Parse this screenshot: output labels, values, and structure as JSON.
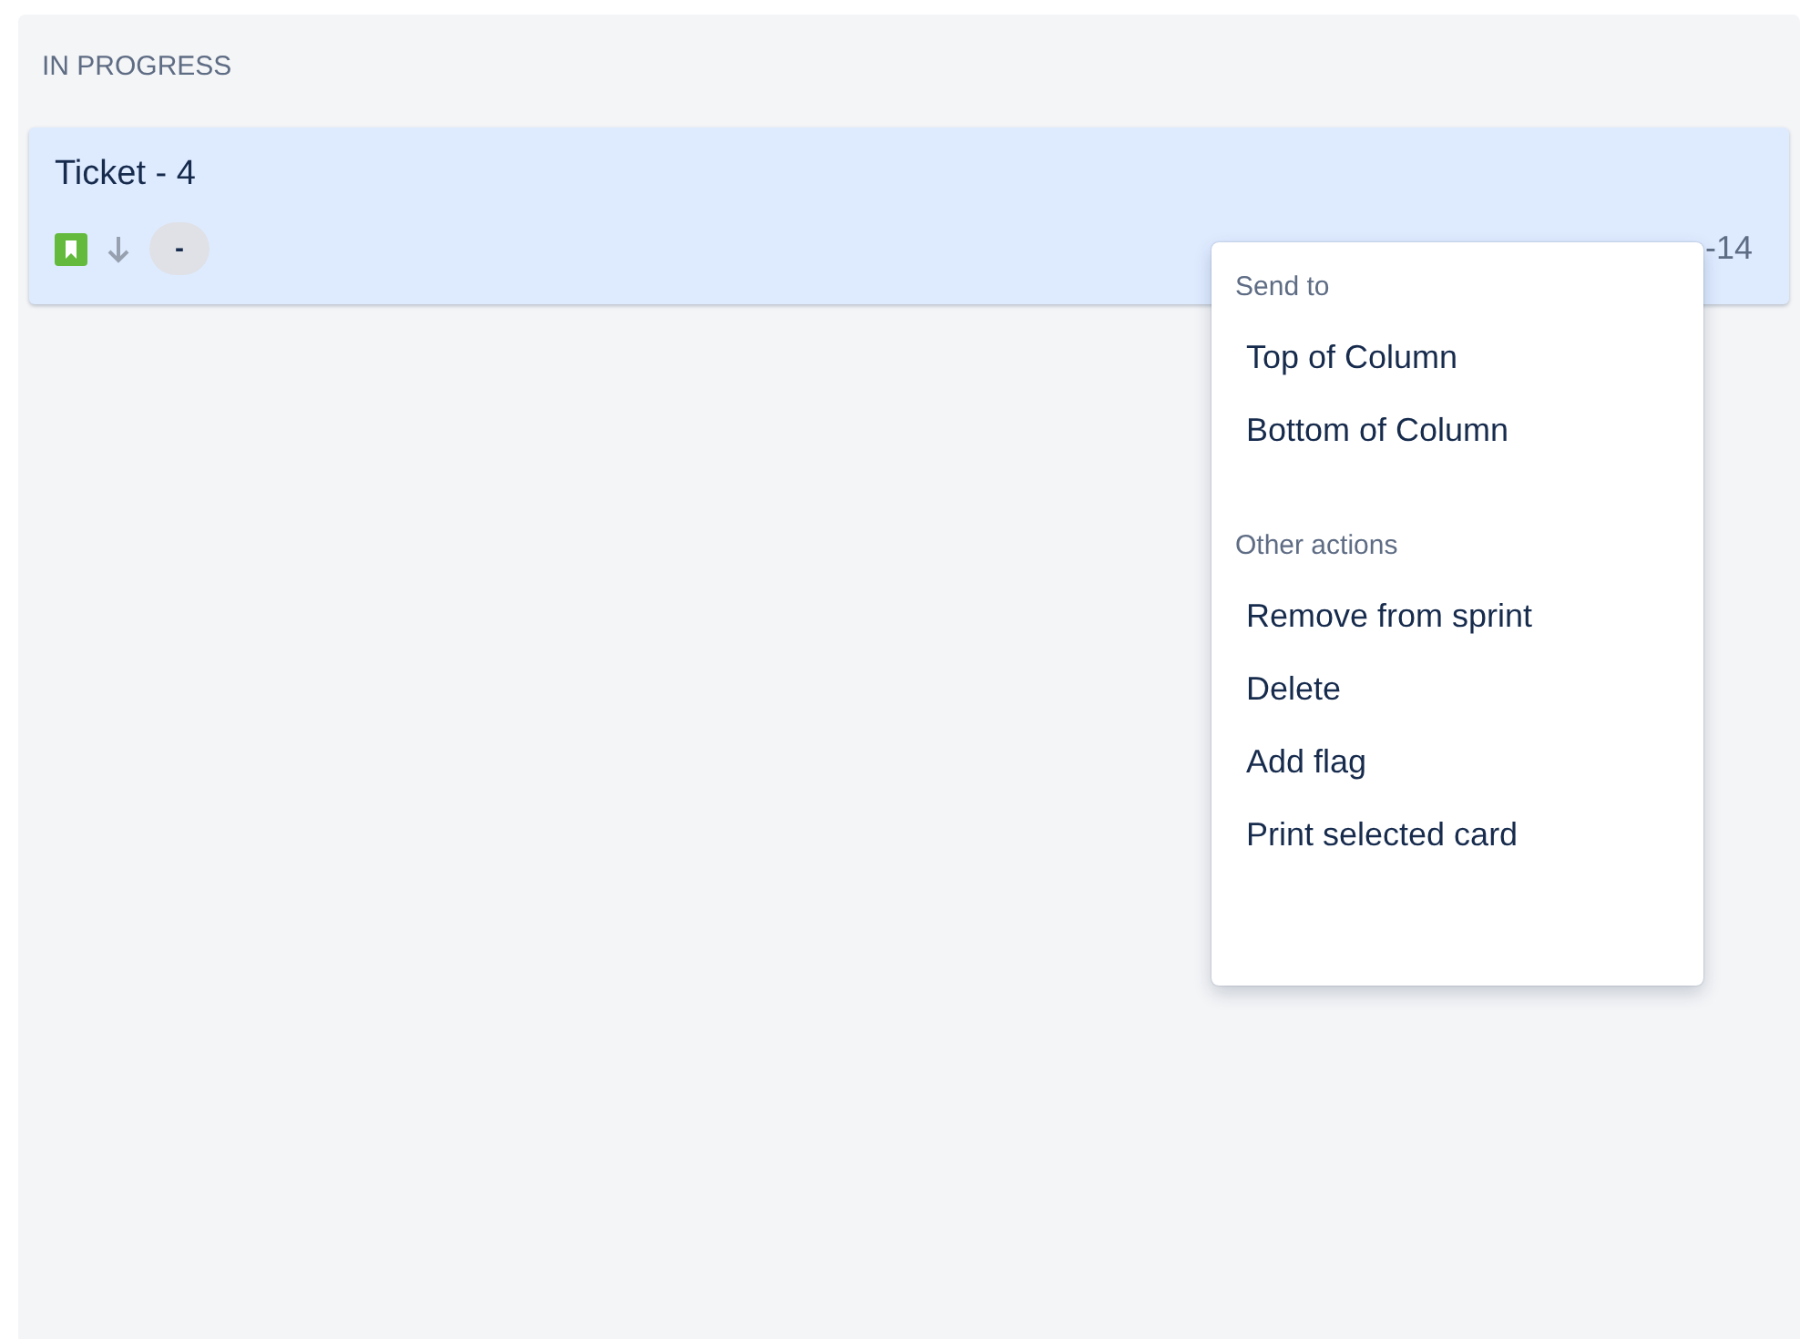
{
  "column": {
    "title": "IN PROGRESS"
  },
  "card": {
    "summary": "Ticket - 4",
    "estimate": "-",
    "key": "-14",
    "selected": true
  },
  "menu": {
    "sections": [
      {
        "heading": "Send to",
        "items": [
          "Top of Column",
          "Bottom of Column"
        ]
      },
      {
        "heading": "Other actions",
        "items": [
          "Remove from sprint",
          "Delete",
          "Add flag",
          "Print selected card"
        ]
      }
    ]
  }
}
